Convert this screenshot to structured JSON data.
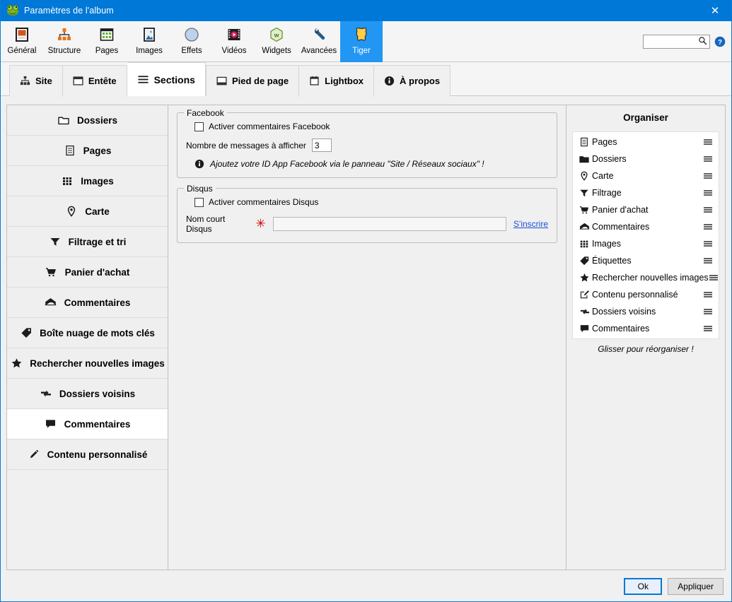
{
  "window": {
    "title": "Paramètres de l'album",
    "app_icon": "frog-icon",
    "close_label": "✕"
  },
  "ribbon": {
    "items": [
      {
        "label": "Général",
        "icon": "general-icon",
        "active": false
      },
      {
        "label": "Structure",
        "icon": "structure-icon",
        "active": false
      },
      {
        "label": "Pages",
        "icon": "pages-icon",
        "active": false
      },
      {
        "label": "Images",
        "icon": "images-icon",
        "active": false
      },
      {
        "label": "Effets",
        "icon": "effects-icon",
        "active": false
      },
      {
        "label": "Vidéos",
        "icon": "videos-icon",
        "active": false
      },
      {
        "label": "Widgets",
        "icon": "widgets-icon",
        "active": false
      },
      {
        "label": "Avancées",
        "icon": "advanced-icon",
        "active": false
      },
      {
        "label": "Tiger",
        "icon": "tiger-icon",
        "active": true
      }
    ],
    "search_value": "",
    "search_placeholder": "",
    "help_icon": "help-icon"
  },
  "tabs": [
    {
      "label": "Site",
      "icon": "sitemap-icon",
      "active": false
    },
    {
      "label": "Entête",
      "icon": "header-icon",
      "active": false
    },
    {
      "label": "Sections",
      "icon": "hamburger-icon",
      "active": true
    },
    {
      "label": "Pied de page",
      "icon": "footer-icon",
      "active": false
    },
    {
      "label": "Lightbox",
      "icon": "lightbox-icon",
      "active": false
    },
    {
      "label": "À propos",
      "icon": "info-icon",
      "active": false
    }
  ],
  "sections_list": [
    {
      "label": "Dossiers",
      "icon": "folder-icon",
      "active": false
    },
    {
      "label": "Pages",
      "icon": "document-icon",
      "active": false
    },
    {
      "label": "Images",
      "icon": "grid-icon",
      "active": false
    },
    {
      "label": "Carte",
      "icon": "pin-icon",
      "active": false
    },
    {
      "label": "Filtrage et tri",
      "icon": "funnel-icon",
      "active": false
    },
    {
      "label": "Panier d'achat",
      "icon": "cart-icon",
      "active": false
    },
    {
      "label": "Commentaires",
      "icon": "envelope-icon",
      "active": false
    },
    {
      "label": "Boîte nuage de mots clés",
      "icon": "tag-icon",
      "active": false
    },
    {
      "label": "Rechercher nouvelles images",
      "icon": "star-icon",
      "active": false
    },
    {
      "label": "Dossiers voisins",
      "icon": "swap-icon",
      "active": false
    },
    {
      "label": "Commentaires",
      "icon": "speech-icon",
      "active": true
    },
    {
      "label": "Contenu personnalisé",
      "icon": "pencil-icon",
      "active": false
    }
  ],
  "facebook": {
    "group_title": "Facebook",
    "enable_label": "Activer commentaires Facebook",
    "enable_checked": false,
    "count_label": "Nombre de messages à afficher",
    "count_value": "3",
    "hint_icon": "info-icon",
    "hint_text": "Ajoutez votre ID App Facebook via le panneau \"Site / Réseaux sociaux\" !"
  },
  "disqus": {
    "group_title": "Disqus",
    "enable_label": "Activer commentaires Disqus",
    "enable_checked": false,
    "shortname_label": "Nom court Disqus",
    "required_mark": "✳",
    "shortname_value": "",
    "shortname_placeholder": "",
    "signup_link": "S'inscrire"
  },
  "organiser": {
    "title": "Organiser",
    "footer_hint": "Glisser pour réorganiser !",
    "items": [
      {
        "label": "Pages",
        "icon": "document-icon"
      },
      {
        "label": "Dossiers",
        "icon": "folder-icon"
      },
      {
        "label": "Carte",
        "icon": "pin-icon"
      },
      {
        "label": "Filtrage",
        "icon": "funnel-icon"
      },
      {
        "label": "Panier d'achat",
        "icon": "cart-icon"
      },
      {
        "label": "Commentaires",
        "icon": "envelope-icon"
      },
      {
        "label": "Images",
        "icon": "grid-icon"
      },
      {
        "label": "Étiquettes",
        "icon": "tag-icon"
      },
      {
        "label": "Rechercher nouvelles images",
        "icon": "star-icon"
      },
      {
        "label": "Contenu personnalisé",
        "icon": "pencil-icon"
      },
      {
        "label": "Dossiers voisins",
        "icon": "swap-icon"
      },
      {
        "label": "Commentaires",
        "icon": "speech-icon"
      }
    ]
  },
  "footer": {
    "ok_label": "Ok",
    "apply_label": "Appliquer"
  },
  "colors": {
    "titlebar": "#0078d7",
    "accent": "#2196f3",
    "link": "#1a4fd6",
    "required": "#d40000"
  }
}
